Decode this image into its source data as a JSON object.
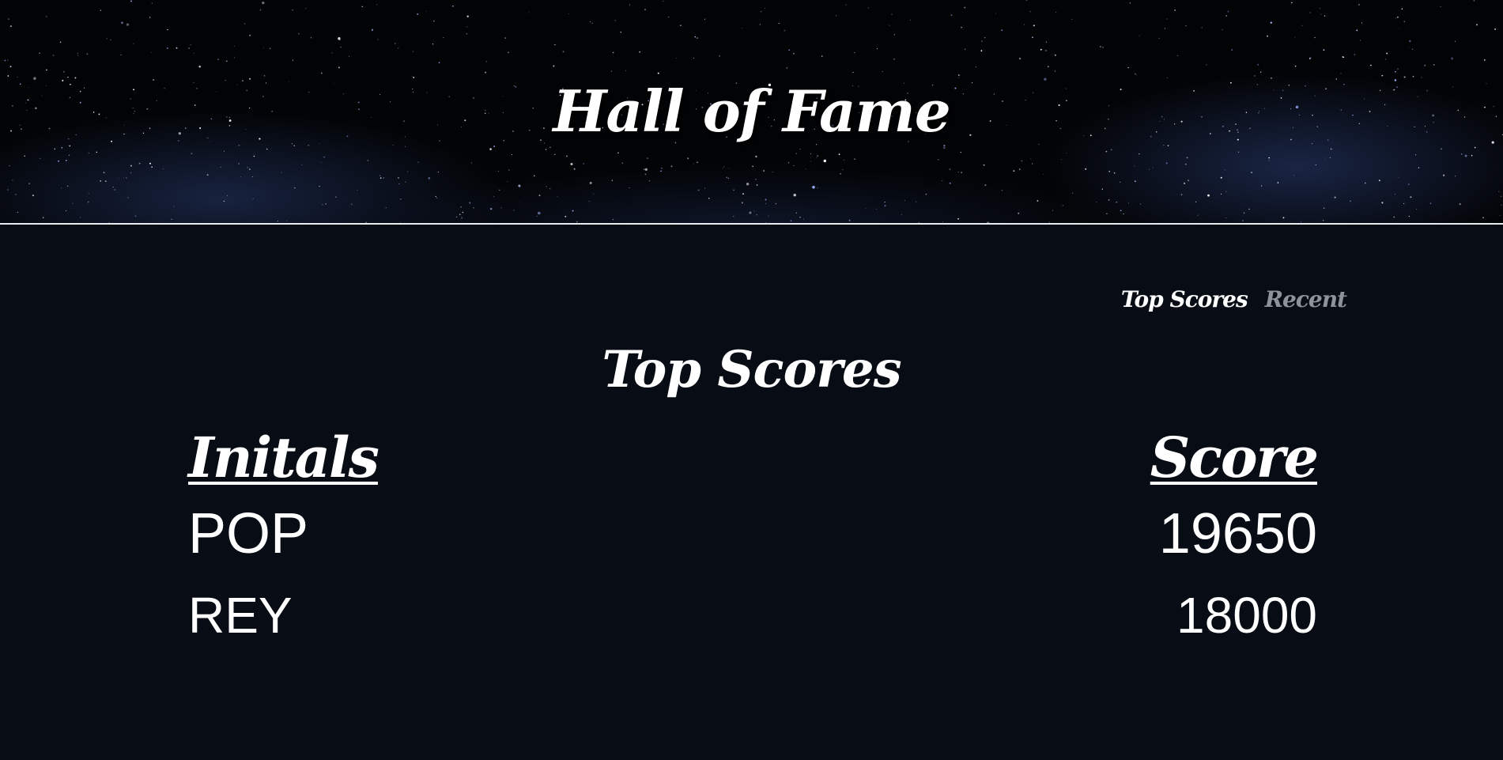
{
  "header": {
    "title": "Hall of Fame"
  },
  "tabs": [
    {
      "label": "Top Scores",
      "active": true
    },
    {
      "label": "Recent",
      "active": false
    }
  ],
  "main": {
    "section_title": "Top Scores",
    "columns": {
      "initials": "Initals",
      "score": "Score"
    },
    "rows": [
      {
        "initials": "POP",
        "score": "19650"
      },
      {
        "initials": "REY",
        "score": "18000"
      }
    ]
  },
  "colors": {
    "background": "#070c15",
    "text": "#ffffff",
    "inactive_tab": "#8f9399",
    "divider": "#e9ecef"
  }
}
